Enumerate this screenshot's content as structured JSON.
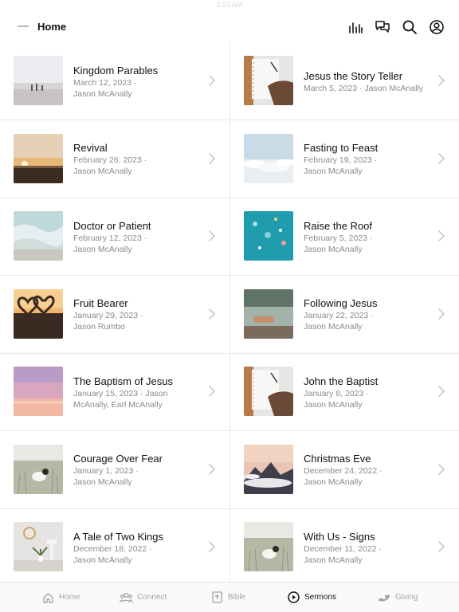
{
  "status_bar": {
    "time": "1:23 AM"
  },
  "header": {
    "title": "Home",
    "icons": [
      "chart-icon",
      "chat-icon",
      "search-icon",
      "account-icon"
    ]
  },
  "sermons": [
    {
      "title": "Kingdom Parables",
      "meta": [
        "March 12, 2023 ·",
        "Jason McAnally"
      ],
      "thumb": "beach-people"
    },
    {
      "title": "Jesus the Story Teller",
      "meta": [
        "March 5, 2023 · Jason McAnally"
      ],
      "thumb": "notebook-writing"
    },
    {
      "title": "Revival",
      "meta": [
        "February 26, 2023 ·",
        "Jason McAnally"
      ],
      "thumb": "sunset-horizon"
    },
    {
      "title": "Fasting to Feast",
      "meta": [
        "February 19, 2023 ·",
        "Jason McAnally"
      ],
      "thumb": "clouds-above"
    },
    {
      "title": "Doctor or Patient",
      "meta": [
        "February 12, 2023 ·",
        "Jason McAnally"
      ],
      "thumb": "ocean-wave"
    },
    {
      "title": "Raise the Roof",
      "meta": [
        "February 5, 2023 ·",
        "Jason McAnally"
      ],
      "thumb": "teal-water"
    },
    {
      "title": "Fruit Bearer",
      "meta": [
        "January 29, 2023 ·",
        "Jason Rumbo"
      ],
      "thumb": "heart-hands"
    },
    {
      "title": "Following Jesus",
      "meta": [
        "January 22, 2023 ·",
        "Jason McAnally"
      ],
      "thumb": "lake-feet"
    },
    {
      "title": "The Baptism of Jesus",
      "meta": [
        "January 15, 2023 · Jason",
        "McAnally, Earl McAnally"
      ],
      "thumb": "pink-sky"
    },
    {
      "title": "John the Baptist",
      "meta": [
        "January 8, 2023 ·",
        "Jason McAnally"
      ],
      "thumb": "notebook-writing"
    },
    {
      "title": "Courage Over Fear",
      "meta": [
        "January 1, 2023 ·",
        "Jason McAnally"
      ],
      "thumb": "lamb-field"
    },
    {
      "title": "Christmas Eve",
      "meta": [
        "December 24, 2022 ·",
        "Jason McAnally"
      ],
      "thumb": "mountain-clouds"
    },
    {
      "title": "A Tale of Two Kings",
      "meta": [
        "December 18, 2022 ·",
        "Jason McAnally"
      ],
      "thumb": "clock-plant"
    },
    {
      "title": "With Us - Signs",
      "meta": [
        "December 11, 2022 ·",
        "Jason McAnally"
      ],
      "thumb": "lamb-field"
    }
  ],
  "tabbar": [
    {
      "label": "Home",
      "icon": "home-icon",
      "active": false
    },
    {
      "label": "Connect",
      "icon": "people-icon",
      "active": false
    },
    {
      "label": "Bible",
      "icon": "bible-icon",
      "active": false
    },
    {
      "label": "Sermons",
      "icon": "play-icon",
      "active": true
    },
    {
      "label": "Giving",
      "icon": "giving-icon",
      "active": false
    }
  ],
  "colors": {
    "divider": "#e8e8e8",
    "meta_text": "#8a8a8a",
    "inactive_tab": "#a4a4a4",
    "active_tab": "#111111"
  }
}
